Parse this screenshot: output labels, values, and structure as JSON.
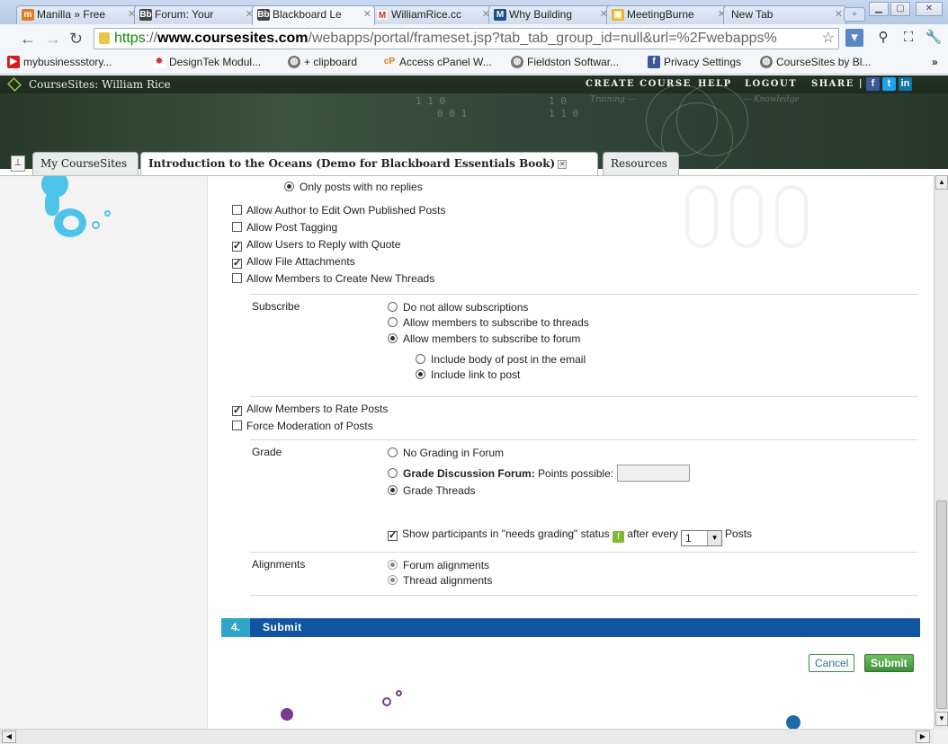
{
  "browser": {
    "tabs": [
      {
        "label": "Manilla » Free",
        "favicon": "manilla-icon"
      },
      {
        "label": "Forum: Your",
        "favicon": "blackboard-icon"
      },
      {
        "label": "Blackboard Le",
        "favicon": "blackboard-icon"
      },
      {
        "label": "WilliamRice.cc",
        "favicon": "gmail-icon"
      },
      {
        "label": "Why Building",
        "favicon": "m-icon"
      },
      {
        "label": "MeetingBurne",
        "favicon": "meeting-icon"
      },
      {
        "label": "New Tab",
        "favicon": ""
      }
    ],
    "url": {
      "scheme": "https",
      "sep": "://",
      "domain": "www.coursesites.com",
      "path": "/webapps/portal/frameset.jsp?tab_tab_group_id=null&url=%2Fwebapps%"
    },
    "bookmarks": [
      "mybusinessstory...",
      "DesignTek Modul...",
      "+ clipboard",
      "Access cPanel W...",
      "Fieldston Softwar...",
      "Privacy Settings",
      "CourseSites by Bl..."
    ],
    "bookmarks_overflow": "»"
  },
  "site": {
    "brand": "CourseSites: William Rice",
    "nav": {
      "create": "CREATE COURSE",
      "help": "HELP",
      "logout": "LOGOUT",
      "share": "SHARE |"
    },
    "banner_words": {
      "training": "Training ---",
      "knowledge": "--- Knowledge",
      "bits1": "1  1  0",
      "bits2": "0  0  1",
      "bits3": "1  0",
      "bits4": "1  1  0"
    },
    "course_tabs": {
      "my": "My CourseSites",
      "current": "Introduction to the Oceans (Demo for Blackboard Essentials Book)",
      "resources": "Resources"
    }
  },
  "form": {
    "only_no_replies": "Only posts with no replies",
    "options": [
      {
        "label": "Allow Author to Edit Own Published Posts",
        "checked": false
      },
      {
        "label": "Allow Post Tagging",
        "checked": false
      },
      {
        "label": "Allow Users to Reply with Quote",
        "checked": true
      },
      {
        "label": "Allow File Attachments",
        "checked": true
      },
      {
        "label": "Allow Members to Create New Threads",
        "checked": false
      }
    ],
    "subscribe": {
      "label": "Subscribe",
      "none": "Do not allow subscriptions",
      "threads": "Allow members to subscribe to threads",
      "forum": "Allow members to subscribe to forum",
      "body": "Include body of post in the email",
      "link": "Include link to post"
    },
    "rate": {
      "label": "Allow Members to Rate Posts",
      "checked": true
    },
    "moderation": {
      "label": "Force Moderation of Posts",
      "checked": false
    },
    "grade": {
      "label": "Grade",
      "none": "No Grading in Forum",
      "forum_bold": "Grade Discussion Forum:",
      "forum_rest": "Points possible:",
      "threads": "Grade Threads",
      "show_prefix": "Show participants in \"needs grading\" status",
      "after_every": "after every",
      "select_value": "1",
      "posts": "Posts"
    },
    "alignments": {
      "label": "Alignments",
      "forum": "Forum alignments",
      "thread": "Thread alignments"
    },
    "step": {
      "number": "4.",
      "title": "Submit"
    },
    "buttons": {
      "cancel": "Cancel",
      "submit": "Submit"
    }
  },
  "colors": {
    "step_bar": "#1155a0",
    "step_number": "#2fa6c9",
    "submit": "#3f8f3a",
    "needs_grading_icon": "#7fb832"
  }
}
